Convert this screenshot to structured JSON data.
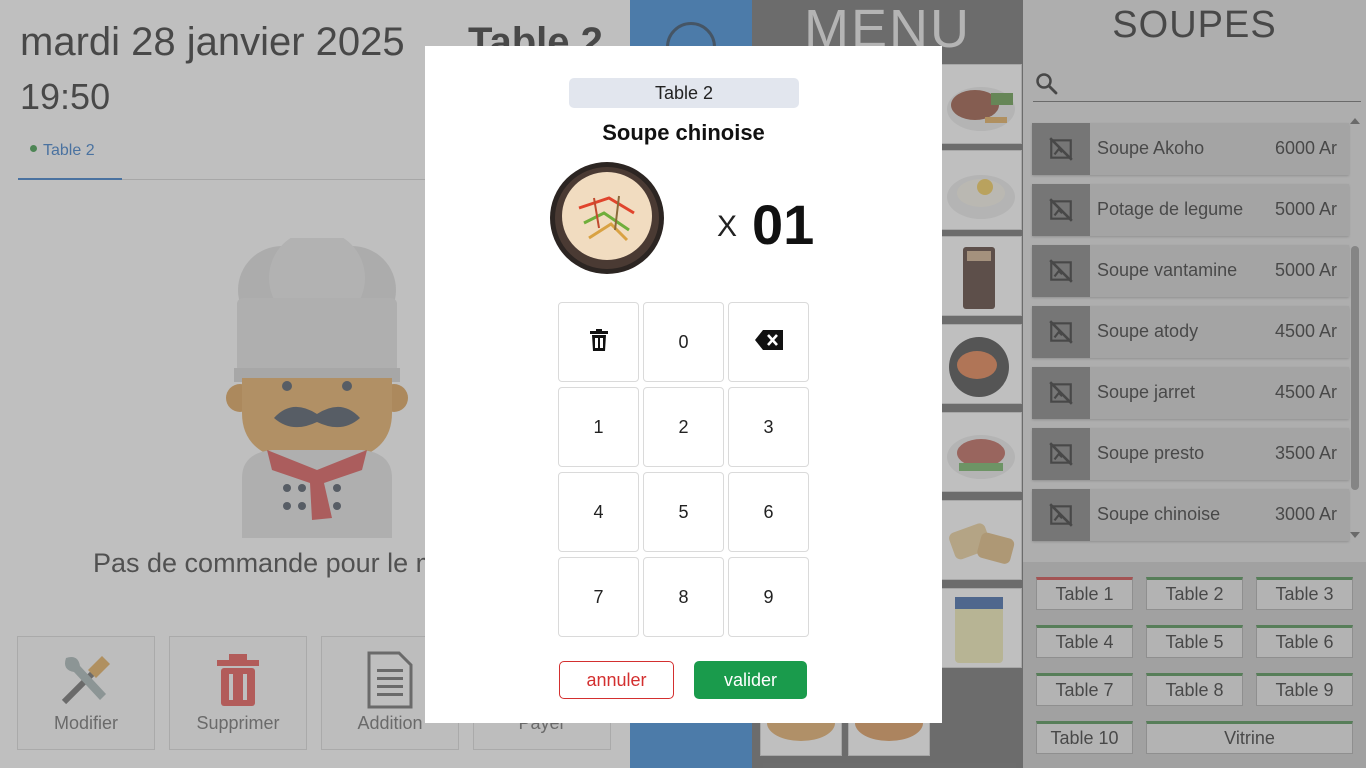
{
  "header": {
    "date": "mardi 28 janvier 2025",
    "time": "19:50",
    "table_title": "Table 2"
  },
  "orders": {
    "tabs": [
      {
        "label": "Table 2"
      }
    ],
    "empty_message": "Pas de commande pour le m"
  },
  "actions": [
    {
      "label": "Modifier",
      "icon": "tools-icon"
    },
    {
      "label": "Supprimer",
      "icon": "trash-icon"
    },
    {
      "label": "Addition",
      "icon": "document-icon"
    },
    {
      "label": "Payer",
      "icon": "cash-icon"
    }
  ],
  "menu": {
    "title": "MENU",
    "tiles": [
      "steak",
      "rice-egg",
      "cola",
      "shrimp",
      "beef-salad",
      "wrap",
      "yogurt",
      "pizza",
      "pizza"
    ]
  },
  "category": {
    "title": "SOUPES",
    "search_placeholder": ""
  },
  "products": [
    {
      "name": "Soupe Akoho",
      "price": "6000 Ar"
    },
    {
      "name": "Potage de legume",
      "price": "5000 Ar"
    },
    {
      "name": "Soupe vantamine",
      "price": "5000 Ar"
    },
    {
      "name": "Soupe atody",
      "price": "4500 Ar"
    },
    {
      "name": "Soupe jarret",
      "price": "4500 Ar"
    },
    {
      "name": "Soupe presto",
      "price": "3500 Ar"
    },
    {
      "name": "Soupe chinoise",
      "price": "3000 Ar"
    }
  ],
  "tables": [
    {
      "label": "Table 1",
      "status": "busy"
    },
    {
      "label": "Table 2",
      "status": "free"
    },
    {
      "label": "Table 3",
      "status": "free"
    },
    {
      "label": "Table 4",
      "status": "free"
    },
    {
      "label": "Table 5",
      "status": "free"
    },
    {
      "label": "Table 6",
      "status": "free"
    },
    {
      "label": "Table 7",
      "status": "free"
    },
    {
      "label": "Table 8",
      "status": "free"
    },
    {
      "label": "Table 9",
      "status": "free"
    },
    {
      "label": "Table 10",
      "status": "free"
    },
    {
      "label": "Vitrine",
      "status": "free"
    }
  ],
  "modal": {
    "table": "Table 2",
    "product": "Soupe chinoise",
    "x_label": "X",
    "quantity": "01",
    "keys": [
      "",
      "0",
      "",
      "1",
      "2",
      "3",
      "4",
      "5",
      "6",
      "7",
      "8",
      "9"
    ],
    "cancel_label": "annuler",
    "confirm_label": "valider"
  },
  "colors": {
    "accent_blue": "#1976d2",
    "confirm_green": "#1a9b4c",
    "cancel_red": "#d32f2f",
    "table_free": "#2e7d32",
    "table_busy": "#c62828"
  }
}
